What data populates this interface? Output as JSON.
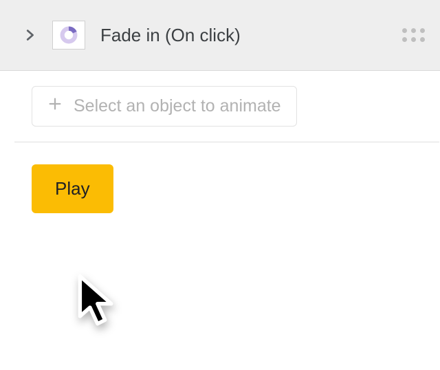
{
  "animation_item": {
    "label": "Fade in  (On click)",
    "thumbnail": "pie-chart"
  },
  "select_object": {
    "label": "Select an object to animate"
  },
  "play_button": {
    "label": "Play"
  },
  "colors": {
    "accent": "#fbbc04",
    "row_bg": "#eeeeee",
    "muted_text": "#b2b2b2"
  }
}
